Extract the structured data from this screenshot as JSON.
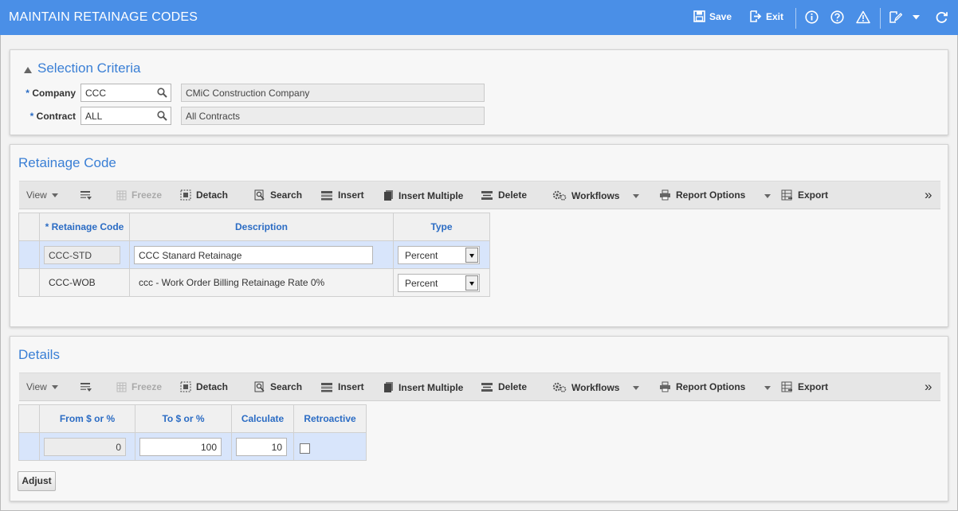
{
  "header": {
    "title": "MAINTAIN RETAINAGE CODES",
    "save_label": "Save",
    "exit_label": "Exit",
    "color": "#4a8fe7"
  },
  "selection": {
    "title": "Selection Criteria",
    "company": {
      "label": "Company",
      "required_mark": "*",
      "value": "CCC",
      "description": "CMiC Construction Company"
    },
    "contract": {
      "label": "Contract",
      "required_mark": "*",
      "value": "ALL",
      "description": "All Contracts"
    }
  },
  "toolbar": {
    "view": "View",
    "freeze": "Freeze",
    "detach": "Detach",
    "search": "Search",
    "insert": "Insert",
    "insert_multiple": "Insert Multiple",
    "delete": "Delete",
    "workflows": "Workflows",
    "report_options": "Report Options",
    "export": "Export",
    "more": "»"
  },
  "retainage": {
    "title": "Retainage Code",
    "columns": [
      "* Retainage Code",
      "Description",
      "Type"
    ],
    "rows": [
      {
        "code": "CCC-STD",
        "description": "CCC Stanard Retainage",
        "type": "Percent"
      },
      {
        "code": "CCC-WOB",
        "description": "ccc - Work Order Billing Retainage Rate 0%",
        "type": "Percent"
      }
    ]
  },
  "details": {
    "title": "Details",
    "columns": [
      "From $ or %",
      "To $ or %",
      "Calculate",
      "Retroactive"
    ],
    "rows": [
      {
        "from": "0",
        "to": "100",
        "calculate": "10",
        "retroactive": false
      }
    ],
    "adjust_label": "Adjust"
  }
}
